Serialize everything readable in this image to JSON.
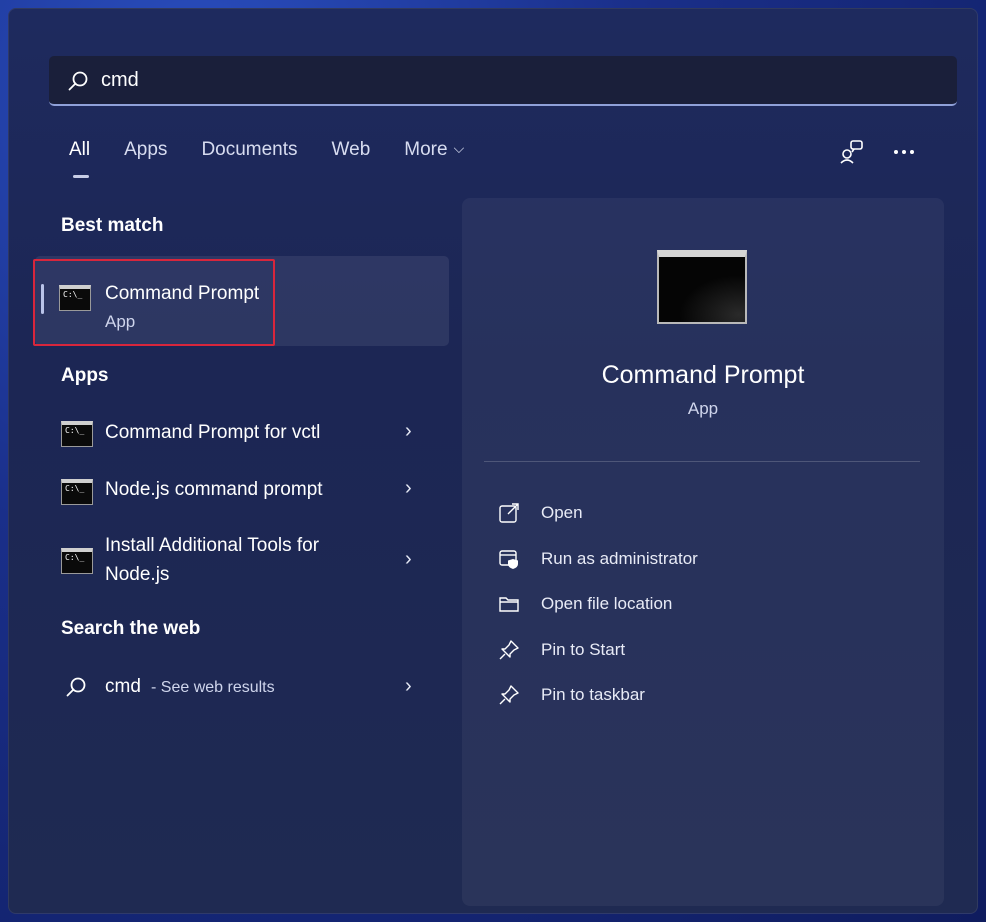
{
  "search": {
    "value": "cmd"
  },
  "tabs": [
    {
      "label": "All"
    },
    {
      "label": "Apps"
    },
    {
      "label": "Documents"
    },
    {
      "label": "Web"
    },
    {
      "label": "More"
    }
  ],
  "sections": {
    "best_match": "Best match",
    "apps": "Apps",
    "search_web": "Search the web"
  },
  "best_match": {
    "title": "Command Prompt",
    "subtitle": "App"
  },
  "apps": [
    {
      "title": "Command Prompt for vctl"
    },
    {
      "title": "Node.js command prompt"
    },
    {
      "title_line1": "Install Additional Tools for",
      "title_line2": "Node.js"
    }
  ],
  "web": {
    "query": "cmd",
    "suffix": " - See web results"
  },
  "detail": {
    "title": "Command Prompt",
    "subtitle": "App",
    "actions": [
      {
        "label": "Open",
        "icon": "open-icon"
      },
      {
        "label": "Run as administrator",
        "icon": "shield-icon"
      },
      {
        "label": "Open file location",
        "icon": "folder-icon"
      },
      {
        "label": "Pin to Start",
        "icon": "pin-icon"
      },
      {
        "label": "Pin to taskbar",
        "icon": "pin-icon"
      }
    ]
  },
  "icon_glyphs": {
    "cmd": "C:\\_",
    "chevron_right": "›",
    "chevron_down": "⌵"
  },
  "colors": {
    "accent": "#b9c3e8",
    "highlight_border": "#d8263c"
  }
}
